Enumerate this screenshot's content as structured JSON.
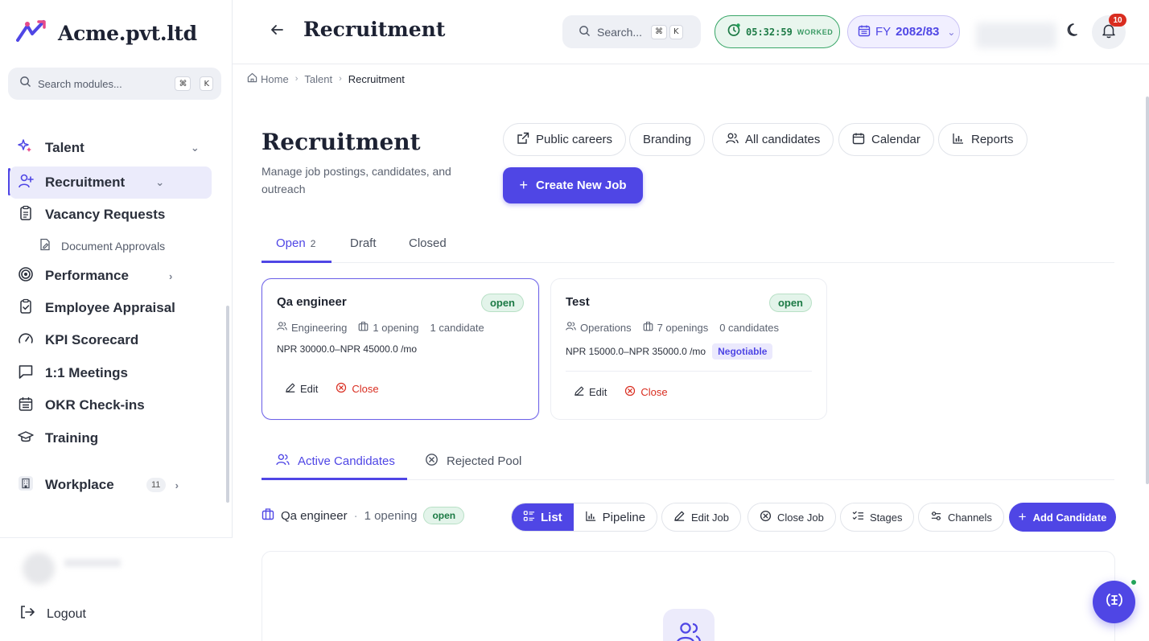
{
  "brand": {
    "name": "Acme.pvt.ltd"
  },
  "sidebar": {
    "search_placeholder": "Search modules...",
    "search_kbd": [
      "⌘",
      "K"
    ],
    "items": [
      {
        "label": "Talent",
        "icon": "sparkle-icon"
      },
      {
        "label": "Recruitment",
        "icon": "user-plus-icon",
        "active": true
      },
      {
        "label": "Vacancy Requests",
        "icon": "clipboard-icon"
      },
      {
        "label": "Document Approvals",
        "icon": "file-edit-icon"
      },
      {
        "label": "Performance",
        "icon": "target-icon"
      },
      {
        "label": "Employee Appraisal",
        "icon": "clipboard-check-icon"
      },
      {
        "label": "KPI Scorecard",
        "icon": "gauge-icon"
      },
      {
        "label": "1:1 Meetings",
        "icon": "message-square-icon"
      },
      {
        "label": "OKR Check-ins",
        "icon": "calendar-check-icon"
      },
      {
        "label": "Training",
        "icon": "graduation-cap-icon"
      },
      {
        "label": "Workplace",
        "icon": "building-icon",
        "count": "11"
      }
    ],
    "logout": "Logout"
  },
  "header": {
    "title": "Recruitment",
    "search_placeholder": "Search...",
    "search_kbd": [
      "⌘",
      "K"
    ],
    "timer": {
      "time": "05:32:59",
      "label": "WORKED"
    },
    "fy": {
      "prefix": "FY",
      "year": "2082/83"
    },
    "notifications": "10"
  },
  "breadcrumb": [
    "Home",
    "Talent",
    "Recruitment"
  ],
  "page": {
    "title": "Recruitment",
    "subtitle": "Manage job postings, candidates, and outreach",
    "actions": [
      "Public careers",
      "Branding",
      "All candidates",
      "Calendar",
      "Reports"
    ],
    "create_label": "Create New Job"
  },
  "job_tabs": [
    {
      "label": "Open",
      "count": "2"
    },
    {
      "label": "Draft"
    },
    {
      "label": "Closed"
    }
  ],
  "jobs": [
    {
      "title": "Qa engineer",
      "status": "open",
      "department": "Engineering",
      "openings": "1 opening",
      "candidates": "1 candidate",
      "salary": "NPR 30000.0–NPR 45000.0 /mo",
      "edit": "Edit",
      "close": "Close"
    },
    {
      "title": "Test",
      "status": "open",
      "department": "Operations",
      "openings": "7 openings",
      "candidates": "0 candidates",
      "salary": "NPR 15000.0–NPR 35000.0 /mo",
      "negotiable": "Negotiable",
      "edit": "Edit",
      "close": "Close"
    }
  ],
  "candidate_tabs": [
    "Active Candidates",
    "Rejected Pool"
  ],
  "selected_job": {
    "title": "Qa engineer",
    "separator": "·",
    "openings": "1 opening",
    "status": "open"
  },
  "view_toggle": [
    "List",
    "Pipeline"
  ],
  "tools": [
    "Edit Job",
    "Close Job",
    "Stages",
    "Channels"
  ],
  "add_candidate": "Add Candidate",
  "colors": {
    "accent": "#4f46e5",
    "success": "#1c7a45",
    "danger": "#d92d20"
  }
}
